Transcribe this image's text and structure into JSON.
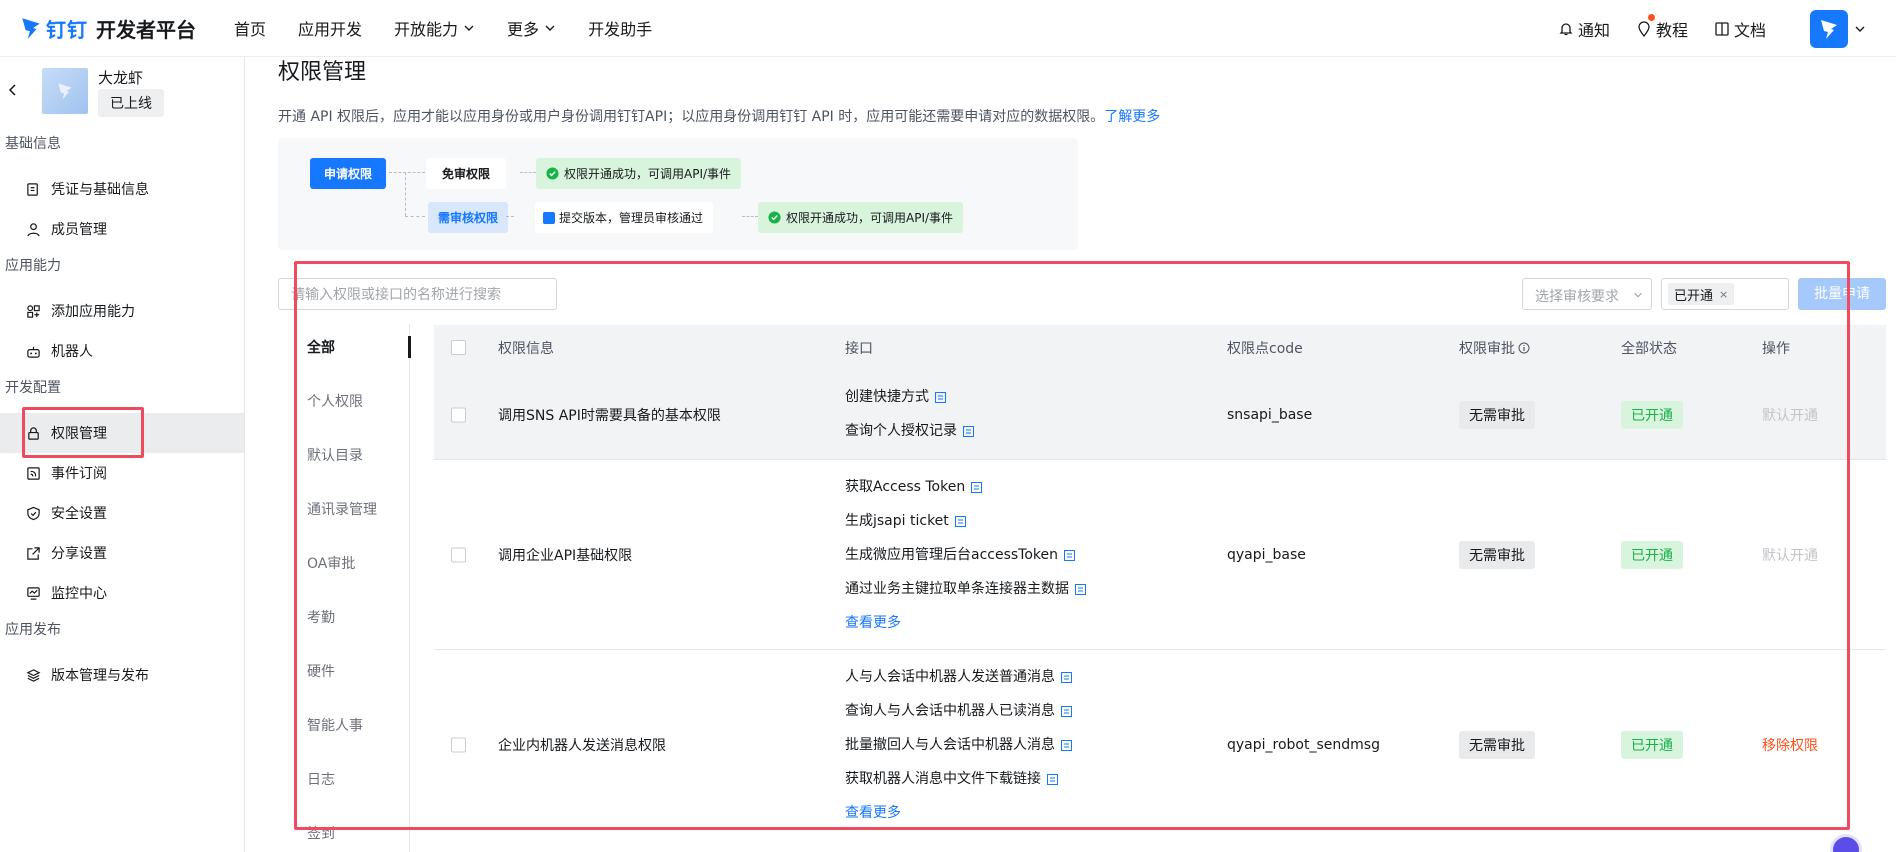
{
  "header": {
    "logo_text": "钉钉",
    "platform_name": "开发者平台",
    "nav": [
      {
        "label": "首页"
      },
      {
        "label": "应用开发"
      },
      {
        "label": "开放能力"
      },
      {
        "label": "更多"
      },
      {
        "label": "开发助手"
      }
    ],
    "right": {
      "notify": "通知",
      "tutorial": "教程",
      "docs": "文档"
    }
  },
  "sidebar": {
    "app_name": "大龙虾",
    "app_status": "已上线",
    "groups": [
      {
        "title": "基础信息",
        "items": [
          {
            "label": "凭证与基础信息"
          },
          {
            "label": "成员管理"
          }
        ]
      },
      {
        "title": "应用能力",
        "items": [
          {
            "label": "添加应用能力"
          },
          {
            "label": "机器人"
          }
        ]
      },
      {
        "title": "开发配置",
        "items": [
          {
            "label": "权限管理"
          },
          {
            "label": "事件订阅"
          },
          {
            "label": "安全设置"
          },
          {
            "label": "分享设置"
          },
          {
            "label": "监控中心"
          }
        ]
      },
      {
        "title": "应用发布",
        "items": [
          {
            "label": "版本管理与发布"
          }
        ]
      }
    ]
  },
  "main": {
    "title": "权限管理",
    "desc": "开通 API 权限后，应用才能以应用身份或用户身份调用钉钉API；以应用身份调用钉钉 API 时，应用可能还需要申请对应的数据权限。",
    "learn_more": "了解更多",
    "flow": {
      "apply": "申请权限",
      "free": "免审权限",
      "review": "需审核权限",
      "submit": "提交版本，管理员审核通过",
      "success": "权限开通成功，可调用API/事件"
    },
    "search_placeholder": "请输入权限或接口的名称进行搜索",
    "review_select_placeholder": "选择审核要求",
    "status_tag": "已开通",
    "tag_close": "×",
    "batch_button": "批量申请",
    "categories": [
      {
        "label": "全部"
      },
      {
        "label": "个人权限"
      },
      {
        "label": "默认目录"
      },
      {
        "label": "通讯录管理"
      },
      {
        "label": "OA审批"
      },
      {
        "label": "考勤"
      },
      {
        "label": "硬件"
      },
      {
        "label": "智能人事"
      },
      {
        "label": "日志"
      },
      {
        "label": "签到"
      }
    ],
    "table": {
      "headers": {
        "info": "权限信息",
        "api": "接口",
        "code": "权限点code",
        "review": "权限审批",
        "status": "全部状态",
        "op": "操作"
      },
      "rows": [
        {
          "info": "调用SNS API时需要具备的基本权限",
          "apis": [
            "创建快捷方式",
            "查询个人授权记录"
          ],
          "more": "",
          "code": "snsapi_base",
          "review": "无需审批",
          "status": "已开通",
          "op": "默认开通"
        },
        {
          "info": "调用企业API基础权限",
          "apis": [
            "获取Access Token",
            "生成jsapi ticket",
            "生成微应用管理后台accessToken",
            "通过业务主键拉取单条连接器主数据"
          ],
          "more": "查看更多",
          "code": "qyapi_base",
          "review": "无需审批",
          "status": "已开通",
          "op": "默认开通"
        },
        {
          "info": "企业内机器人发送消息权限",
          "apis": [
            "人与人会话中机器人发送普通消息",
            "查询人与人会话中机器人已读消息",
            "批量撤回人与人会话中机器人消息",
            "获取机器人消息中文件下载链接"
          ],
          "more": "查看更多",
          "code": "qyapi_robot_sendmsg",
          "review": "无需审批",
          "status": "已开通",
          "op": "移除权限"
        }
      ]
    }
  },
  "colors": {
    "brand": "#1677ff",
    "success_bg": "#d9f4dc",
    "success_text": "#17b248",
    "danger": "#ff5219",
    "highlight": "#f04a5e"
  }
}
